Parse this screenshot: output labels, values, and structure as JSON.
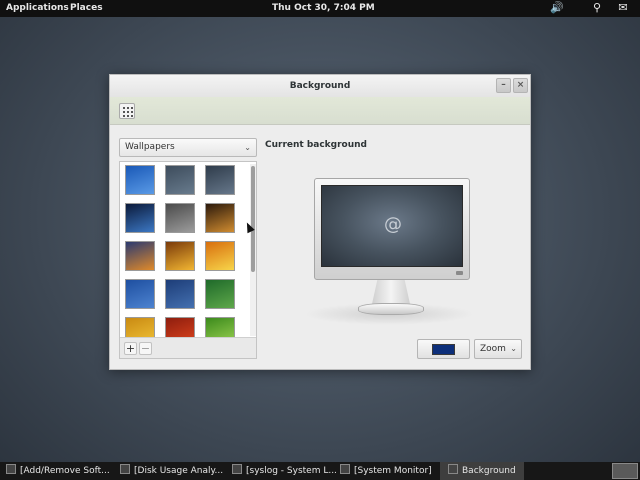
{
  "top_panel": {
    "applications": "Applications",
    "places": "Places",
    "clock": "Thu Oct 30,  7:04 PM",
    "tray_icons": [
      "volume-icon",
      "accessibility-icon",
      "chat-icon"
    ]
  },
  "window": {
    "title": "Background",
    "buttons": {
      "minimize": "–",
      "close": "×"
    },
    "toolbar_icon": "grid-icon",
    "source_dropdown": {
      "selected": "Wallpapers",
      "chevron": "⌄"
    },
    "current_background_label": "Current background",
    "thumbnail_controls": {
      "add": "+",
      "remove": "−"
    },
    "color_button_swatch": "#0d2f7a",
    "placement_combo": {
      "selected": "Zoom",
      "chevron": "⌄"
    },
    "wallpapers": [
      {
        "name": "debian-blue-lines",
        "colors": [
          "#1a59b7",
          "#5a9ae6"
        ]
      },
      {
        "name": "grey-swirl",
        "colors": [
          "#3d4c5c",
          "#687b8d"
        ]
      },
      {
        "name": "dark-blue-swirl",
        "colors": [
          "#2f3c4b",
          "#66778a"
        ]
      },
      {
        "name": "earth",
        "colors": [
          "#0b1a3a",
          "#3c78c4"
        ]
      },
      {
        "name": "grey-stripes",
        "colors": [
          "#4b4b4b",
          "#9c9c9c"
        ]
      },
      {
        "name": "sunset-field",
        "colors": [
          "#2c1a0c",
          "#d08c30"
        ]
      },
      {
        "name": "orange-horizon",
        "colors": [
          "#2b3a70",
          "#e08a2a"
        ]
      },
      {
        "name": "golden-glow",
        "colors": [
          "#7a3a0a",
          "#f2b632"
        ]
      },
      {
        "name": "yellow-sun",
        "colors": [
          "#d86f0e",
          "#f7d54a"
        ]
      },
      {
        "name": "blue-gradient",
        "colors": [
          "#1e4fa0",
          "#4d83d0"
        ]
      },
      {
        "name": "navy-gradient",
        "colors": [
          "#1d3d78",
          "#4470b0"
        ]
      },
      {
        "name": "green-gradient",
        "colors": [
          "#1f6a2a",
          "#5ea84a"
        ]
      },
      {
        "name": "amber",
        "colors": [
          "#c98a12",
          "#f2c53a"
        ]
      },
      {
        "name": "red-stripes",
        "colors": [
          "#8e1d0e",
          "#e0461e"
        ]
      },
      {
        "name": "green-leaves",
        "colors": [
          "#3c8a1c",
          "#9ed454"
        ]
      }
    ]
  },
  "taskbar": {
    "tasks": [
      "[Add/Remove Soft...",
      "[Disk Usage Analy...",
      "[syslog - System L...",
      "[System Monitor]",
      "Background"
    ],
    "active_task": "Background"
  }
}
